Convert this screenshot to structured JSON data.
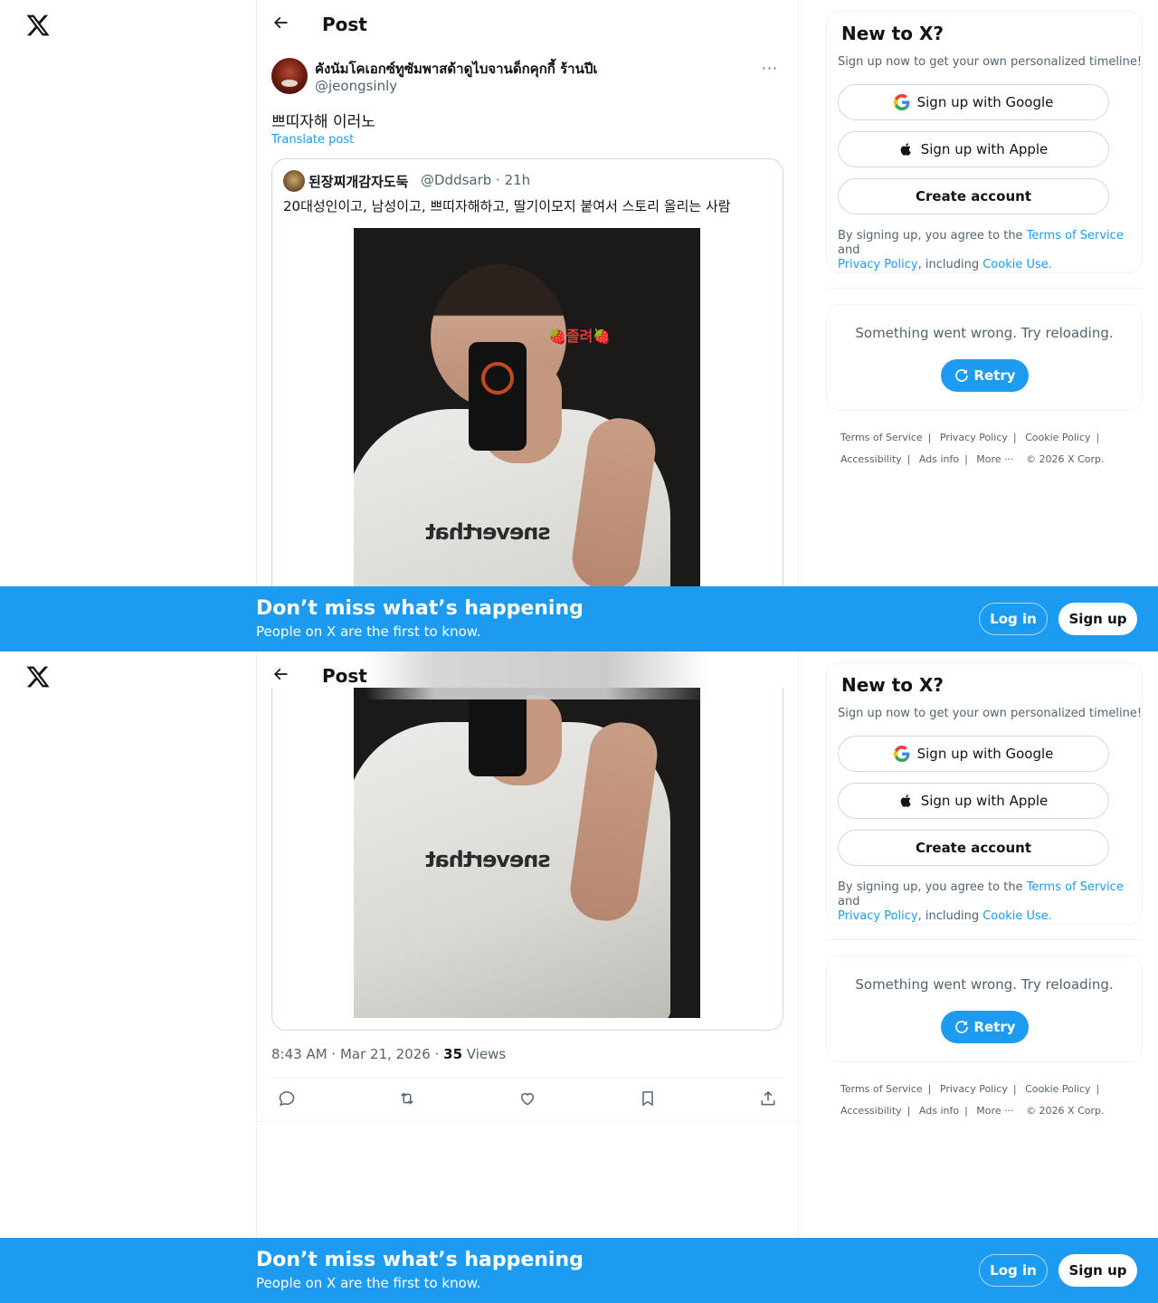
{
  "nav": {
    "logo_icon": "x-logo-icon"
  },
  "header": {
    "title": "Post",
    "back_icon": "arrow-left-icon"
  },
  "post": {
    "author_name": "คังนัมโคเอกซ์ทูซัมพาสด้าดูไบจานด็กคุกกี้ ร้านปีเ",
    "author_handle": "@jeongsinly",
    "more_label": "···",
    "text": "쁘띠자해 이러노",
    "translate_label": "Translate post",
    "quote": {
      "name": "된장찌개감자도둑",
      "handle_time": "@Dddsarb · 21h",
      "text": "20대성인이고, 남성이고, 쁘띠자해하고, 딸기이모지 붙여서 스토리 올리는 사람",
      "sticker_text": "🍓졸려🍓",
      "shirt_text": "sneverthat"
    },
    "time": "8:43 AM · Mar 21, 2026 · ",
    "views_count": "35",
    "views_label": " Views",
    "actions": [
      "reply-icon",
      "repost-icon",
      "like-icon",
      "bookmark-icon",
      "share-icon"
    ]
  },
  "sidebar": {
    "title": "New to X?",
    "subtitle": "Sign up now to get your own personalized timeline!",
    "google_label": "Sign up with Google",
    "apple_label": "Sign up with Apple",
    "create_label": "Create account",
    "legal_prefix": "By signing up, you agree to the ",
    "terms_label": "Terms of Service",
    "legal_and": " and",
    "privacy_label": "Privacy Policy",
    "legal_including": ", including ",
    "cookie_label": "Cookie Use.",
    "error_text": "Something went wrong. Try reloading.",
    "retry_label": "Retry",
    "footer": {
      "terms": "Terms of Service",
      "privacy": "Privacy Policy",
      "cookie": "Cookie Policy",
      "accessibility": "Accessibility",
      "ads": "Ads info",
      "more": "More ···",
      "copyright": "© 2026 X Corp."
    }
  },
  "banner": {
    "title": "Don’t miss what’s happening",
    "subtitle": "People on X are the first to know.",
    "login_label": "Log in",
    "signup_label": "Sign up"
  },
  "colors": {
    "accent": "#1d9bf0",
    "text": "#0f1419",
    "muted": "#536471",
    "border": "#cfd9de"
  }
}
